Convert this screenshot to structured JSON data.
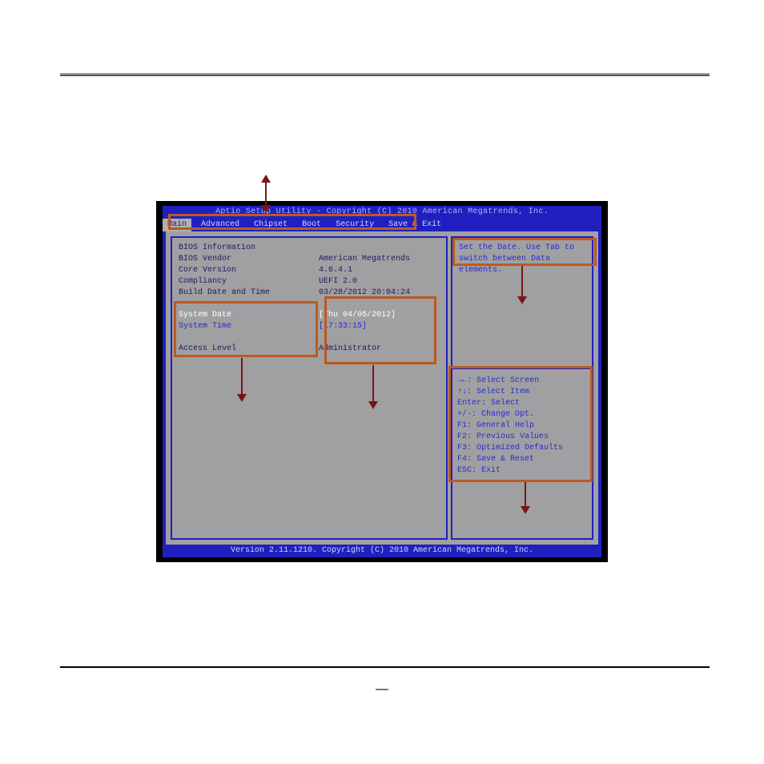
{
  "header": {
    "title": "Aptio Setup Utility - Copyright (C) 2010 American Megatrends, Inc."
  },
  "menu": {
    "items": [
      {
        "label": "Main",
        "selected": true
      },
      {
        "label": "Advanced",
        "selected": false
      },
      {
        "label": "Chipset",
        "selected": false
      },
      {
        "label": "Boot",
        "selected": false
      },
      {
        "label": "Security",
        "selected": false
      },
      {
        "label": "Save & Exit",
        "selected": false
      }
    ]
  },
  "left_panel": {
    "section_title": "BIOS Information",
    "rows": [
      {
        "label": "BIOS Vendor",
        "value": "American Megatrends"
      },
      {
        "label": "Core Version",
        "value": "4.6.4.1"
      },
      {
        "label": "Compliancy",
        "value": "UEFI 2.0"
      },
      {
        "label": "Build Date and Time",
        "value": "03/28/2012 20:04:24"
      }
    ],
    "system_date": {
      "label": "System Date",
      "value": "[Thu 04/05/2012]"
    },
    "system_time": {
      "label": "System Time",
      "value": "[17:33:15]"
    },
    "access_level": {
      "label": "Access Level",
      "value": "Administrator"
    }
  },
  "right_panel": {
    "help_line1": "Set the Date. Use Tab to",
    "help_line2": "switch between Data elements.",
    "keys": [
      "→←: Select Screen",
      "↑↓: Select Item",
      "Enter: Select",
      "+/-: Change Opt.",
      "F1: General Help",
      "F2: Previous Values",
      "F3: Optimized Defaults",
      "F4: Save & Reset",
      "ESC: Exit"
    ]
  },
  "footer": {
    "text": "Version 2.11.1210. Copyright (C) 2010 American Megatrends, Inc."
  },
  "page": {
    "dash": "—"
  }
}
